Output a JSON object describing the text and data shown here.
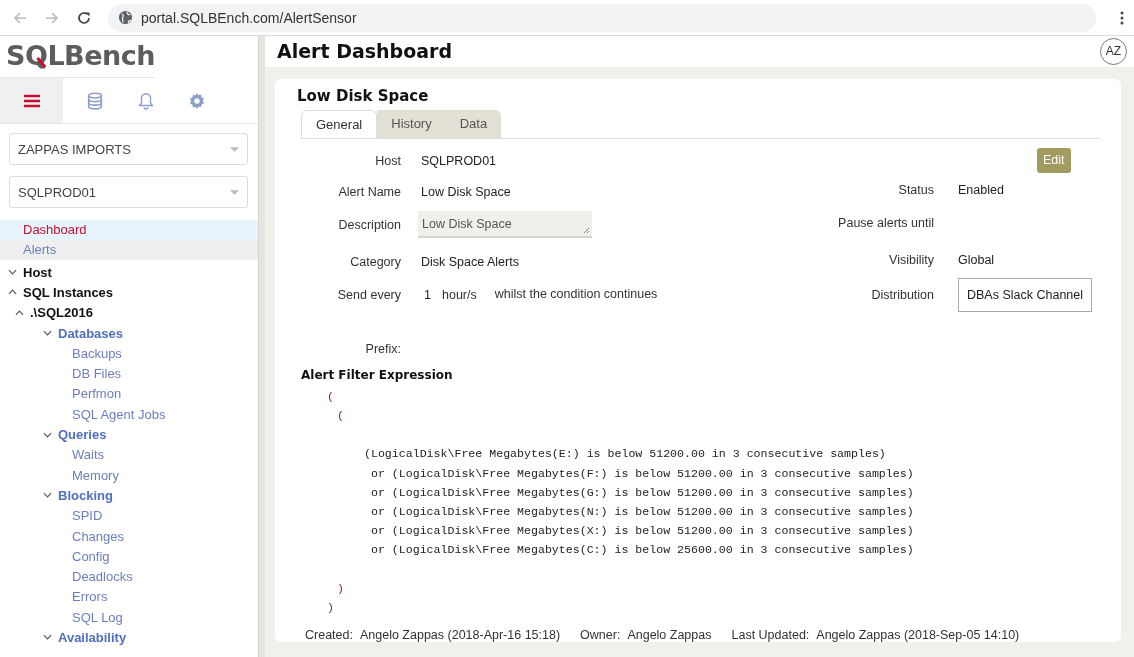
{
  "browser": {
    "url": "portal.SQLBEnch.com/AlertSensor"
  },
  "sidebar": {
    "logo": {
      "before": "S",
      "mark": "Q",
      "after": "LBench"
    },
    "toolbar": [
      {
        "kind": "menu",
        "selected": true
      },
      {
        "kind": "database",
        "selected": false
      },
      {
        "kind": "bell",
        "selected": false
      },
      {
        "kind": "gear",
        "selected": false
      }
    ],
    "selects": [
      {
        "value": "ZAPPAS IMPORTS"
      },
      {
        "value": "SQLPROD01"
      }
    ],
    "nav": [
      {
        "label": "Dashboard",
        "selected": true
      },
      {
        "label": "Alerts",
        "selected": false
      }
    ],
    "tree": [
      {
        "label": "Host",
        "expanded": false
      },
      {
        "label": "SQL Instances",
        "expanded": true,
        "children": [
          {
            "label": ".\\SQL2016",
            "expanded": true,
            "children": [
              {
                "label": "Databases",
                "expanded": false,
                "children": [
                  {
                    "label": "Backups"
                  },
                  {
                    "label": "DB Files"
                  },
                  {
                    "label": "Perfmon"
                  },
                  {
                    "label": "SQL Agent Jobs"
                  }
                ]
              },
              {
                "label": "Queries",
                "expanded": false,
                "children": [
                  {
                    "label": "Waits"
                  },
                  {
                    "label": "Memory"
                  }
                ]
              },
              {
                "label": "Blocking",
                "expanded": false,
                "children": [
                  {
                    "label": "SPID"
                  },
                  {
                    "label": "Changes"
                  },
                  {
                    "label": "Config"
                  },
                  {
                    "label": "Deadlocks"
                  },
                  {
                    "label": "Errors"
                  },
                  {
                    "label": "SQL Log"
                  }
                ]
              },
              {
                "label": "Availability",
                "expanded": false
              }
            ]
          }
        ]
      }
    ]
  },
  "header": {
    "title": "Alert Dashboard",
    "avatar": "AZ"
  },
  "card": {
    "title": "Low Disk Space",
    "tabs": [
      {
        "label": "General",
        "selected": true
      },
      {
        "label": "History",
        "selected": false
      },
      {
        "label": "Data",
        "selected": false
      }
    ],
    "edit_button": "Edit",
    "left_fields": [
      {
        "label": "Host",
        "value": "SQLPROD01",
        "kind": "text"
      },
      {
        "label": "Alert Name",
        "value": "Low Disk Space",
        "kind": "text"
      },
      {
        "label": "Description",
        "value": "Low Disk Space",
        "kind": "textarea"
      },
      {
        "label": "Category",
        "value": "Disk Space Alerts",
        "kind": "text"
      },
      {
        "label": "Send every",
        "value": "1",
        "unit": "hour/s",
        "note": "whilst the condition continues",
        "kind": "interval"
      },
      {
        "label": "Prefix:",
        "kind": "empty"
      }
    ],
    "right_fields": [
      {
        "label": "Status",
        "value": "Enabled",
        "kind": "text"
      },
      {
        "label": "Pause alerts until",
        "kind": "empty"
      },
      {
        "label": "Visibility",
        "value": "Global",
        "kind": "text"
      },
      {
        "label": "Distribution",
        "value": "DBAs Slack Channel",
        "kind": "boxed"
      }
    ],
    "filter_title": "Alert Filter Expression",
    "filter_expression": {
      "open": "(",
      "close": ")",
      "children": [
        {
          "open": "(",
          "close": ")",
          "lines": [
            "(LogicalDisk\\Free Megabytes(E:) is below 51200.00 in 3 consecutive samples)",
            " or (LogicalDisk\\Free Megabytes(F:) is below 51200.00 in 3 consecutive samples)",
            " or (LogicalDisk\\Free Megabytes(G:) is below 51200.00 in 3 consecutive samples)",
            " or (LogicalDisk\\Free Megabytes(N:) is below 51200.00 in 3 consecutive samples)",
            " or (LogicalDisk\\Free Megabytes(X:) is below 51200.00 in 3 consecutive samples)",
            " or (LogicalDisk\\Free Megabytes(C:) is below 25600.00 in 3 consecutive samples)"
          ]
        }
      ]
    },
    "footer": [
      {
        "label": "Created:",
        "value": "Angelo Zappas (2018-Apr-16 15:18)"
      },
      {
        "label": "Owner:",
        "value": "Angelo Zappas"
      },
      {
        "label": "Last Updated:",
        "value": "Angelo Zappas (2018-Sep-05 14:10)"
      }
    ]
  }
}
